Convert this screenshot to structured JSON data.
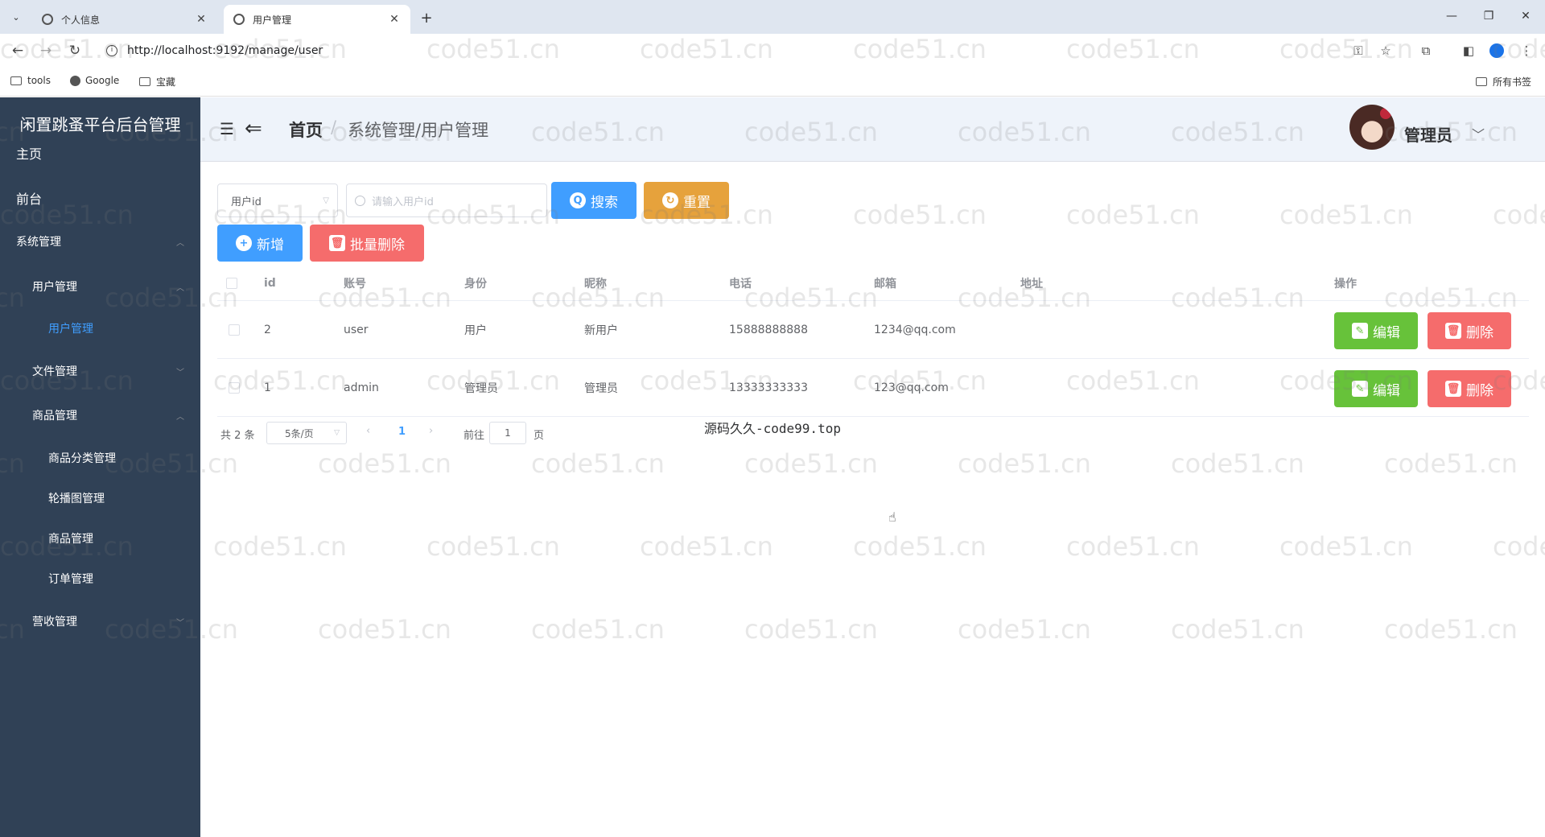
{
  "browser": {
    "tabs": [
      {
        "title": "个人信息",
        "active": false
      },
      {
        "title": "用户管理",
        "active": true
      }
    ],
    "url": "http://localhost:9192/manage/user",
    "bookmarks": [
      {
        "label": "tools",
        "icon": "folder-icon"
      },
      {
        "label": "Google",
        "icon": "google-icon"
      },
      {
        "label": "宝藏",
        "icon": "folder-icon"
      }
    ],
    "bookmarks_right": "所有书签"
  },
  "sidebar": {
    "brand": "闲置跳蚤平台后台管理",
    "items": [
      {
        "label": "主页",
        "level": 0
      },
      {
        "label": "前台",
        "level": 0
      },
      {
        "label": "系统管理",
        "level": 0,
        "arrow": "up"
      },
      {
        "label": "用户管理",
        "level": 1,
        "arrow": "up"
      },
      {
        "label": "用户管理",
        "level": 2,
        "active": true
      },
      {
        "label": "文件管理",
        "level": 1,
        "arrow": "down"
      },
      {
        "label": "商品管理",
        "level": 1,
        "arrow": "up"
      },
      {
        "label": "商品分类管理",
        "level": 2
      },
      {
        "label": "轮播图管理",
        "level": 2
      },
      {
        "label": "商品管理",
        "level": 2
      },
      {
        "label": "订单管理",
        "level": 2
      },
      {
        "label": "营收管理",
        "level": 1,
        "arrow": "down"
      }
    ]
  },
  "header": {
    "crumb_home": "首页",
    "crumb_sep": "/",
    "crumb_path": "系统管理/用户管理",
    "user_name": "管理员"
  },
  "toolbar": {
    "filter_select": "用户id",
    "search_placeholder": "请输入用户id",
    "search_label": "搜索",
    "reset_label": "重置",
    "add_label": "新增",
    "batch_delete_label": "批量删除"
  },
  "table": {
    "columns": [
      "id",
      "账号",
      "身份",
      "昵称",
      "电话",
      "邮箱",
      "地址",
      "操作"
    ],
    "rows": [
      {
        "id": "2",
        "account": "user",
        "role": "用户",
        "nickname": "新用户",
        "phone": "15888888888",
        "email": "1234@qq.com",
        "address": ""
      },
      {
        "id": "1",
        "account": "admin",
        "role": "管理员",
        "nickname": "管理员",
        "phone": "13333333333",
        "email": "123@qq.com",
        "address": ""
      }
    ],
    "edit_label": "编辑",
    "delete_label": "删除"
  },
  "pager": {
    "total": "共 2 条",
    "page_size": "5条/页",
    "current_page": "1",
    "goto_label": "前往",
    "goto_value": "1",
    "page_unit": "页"
  },
  "footer_note": "源码久久-code99.top",
  "watermark_text": "code51.cn",
  "colors": {
    "sidebar_bg": "#304156",
    "primary": "#409eff",
    "warning": "#e6a23c",
    "danger": "#f56c6c",
    "success": "#67c23a"
  }
}
